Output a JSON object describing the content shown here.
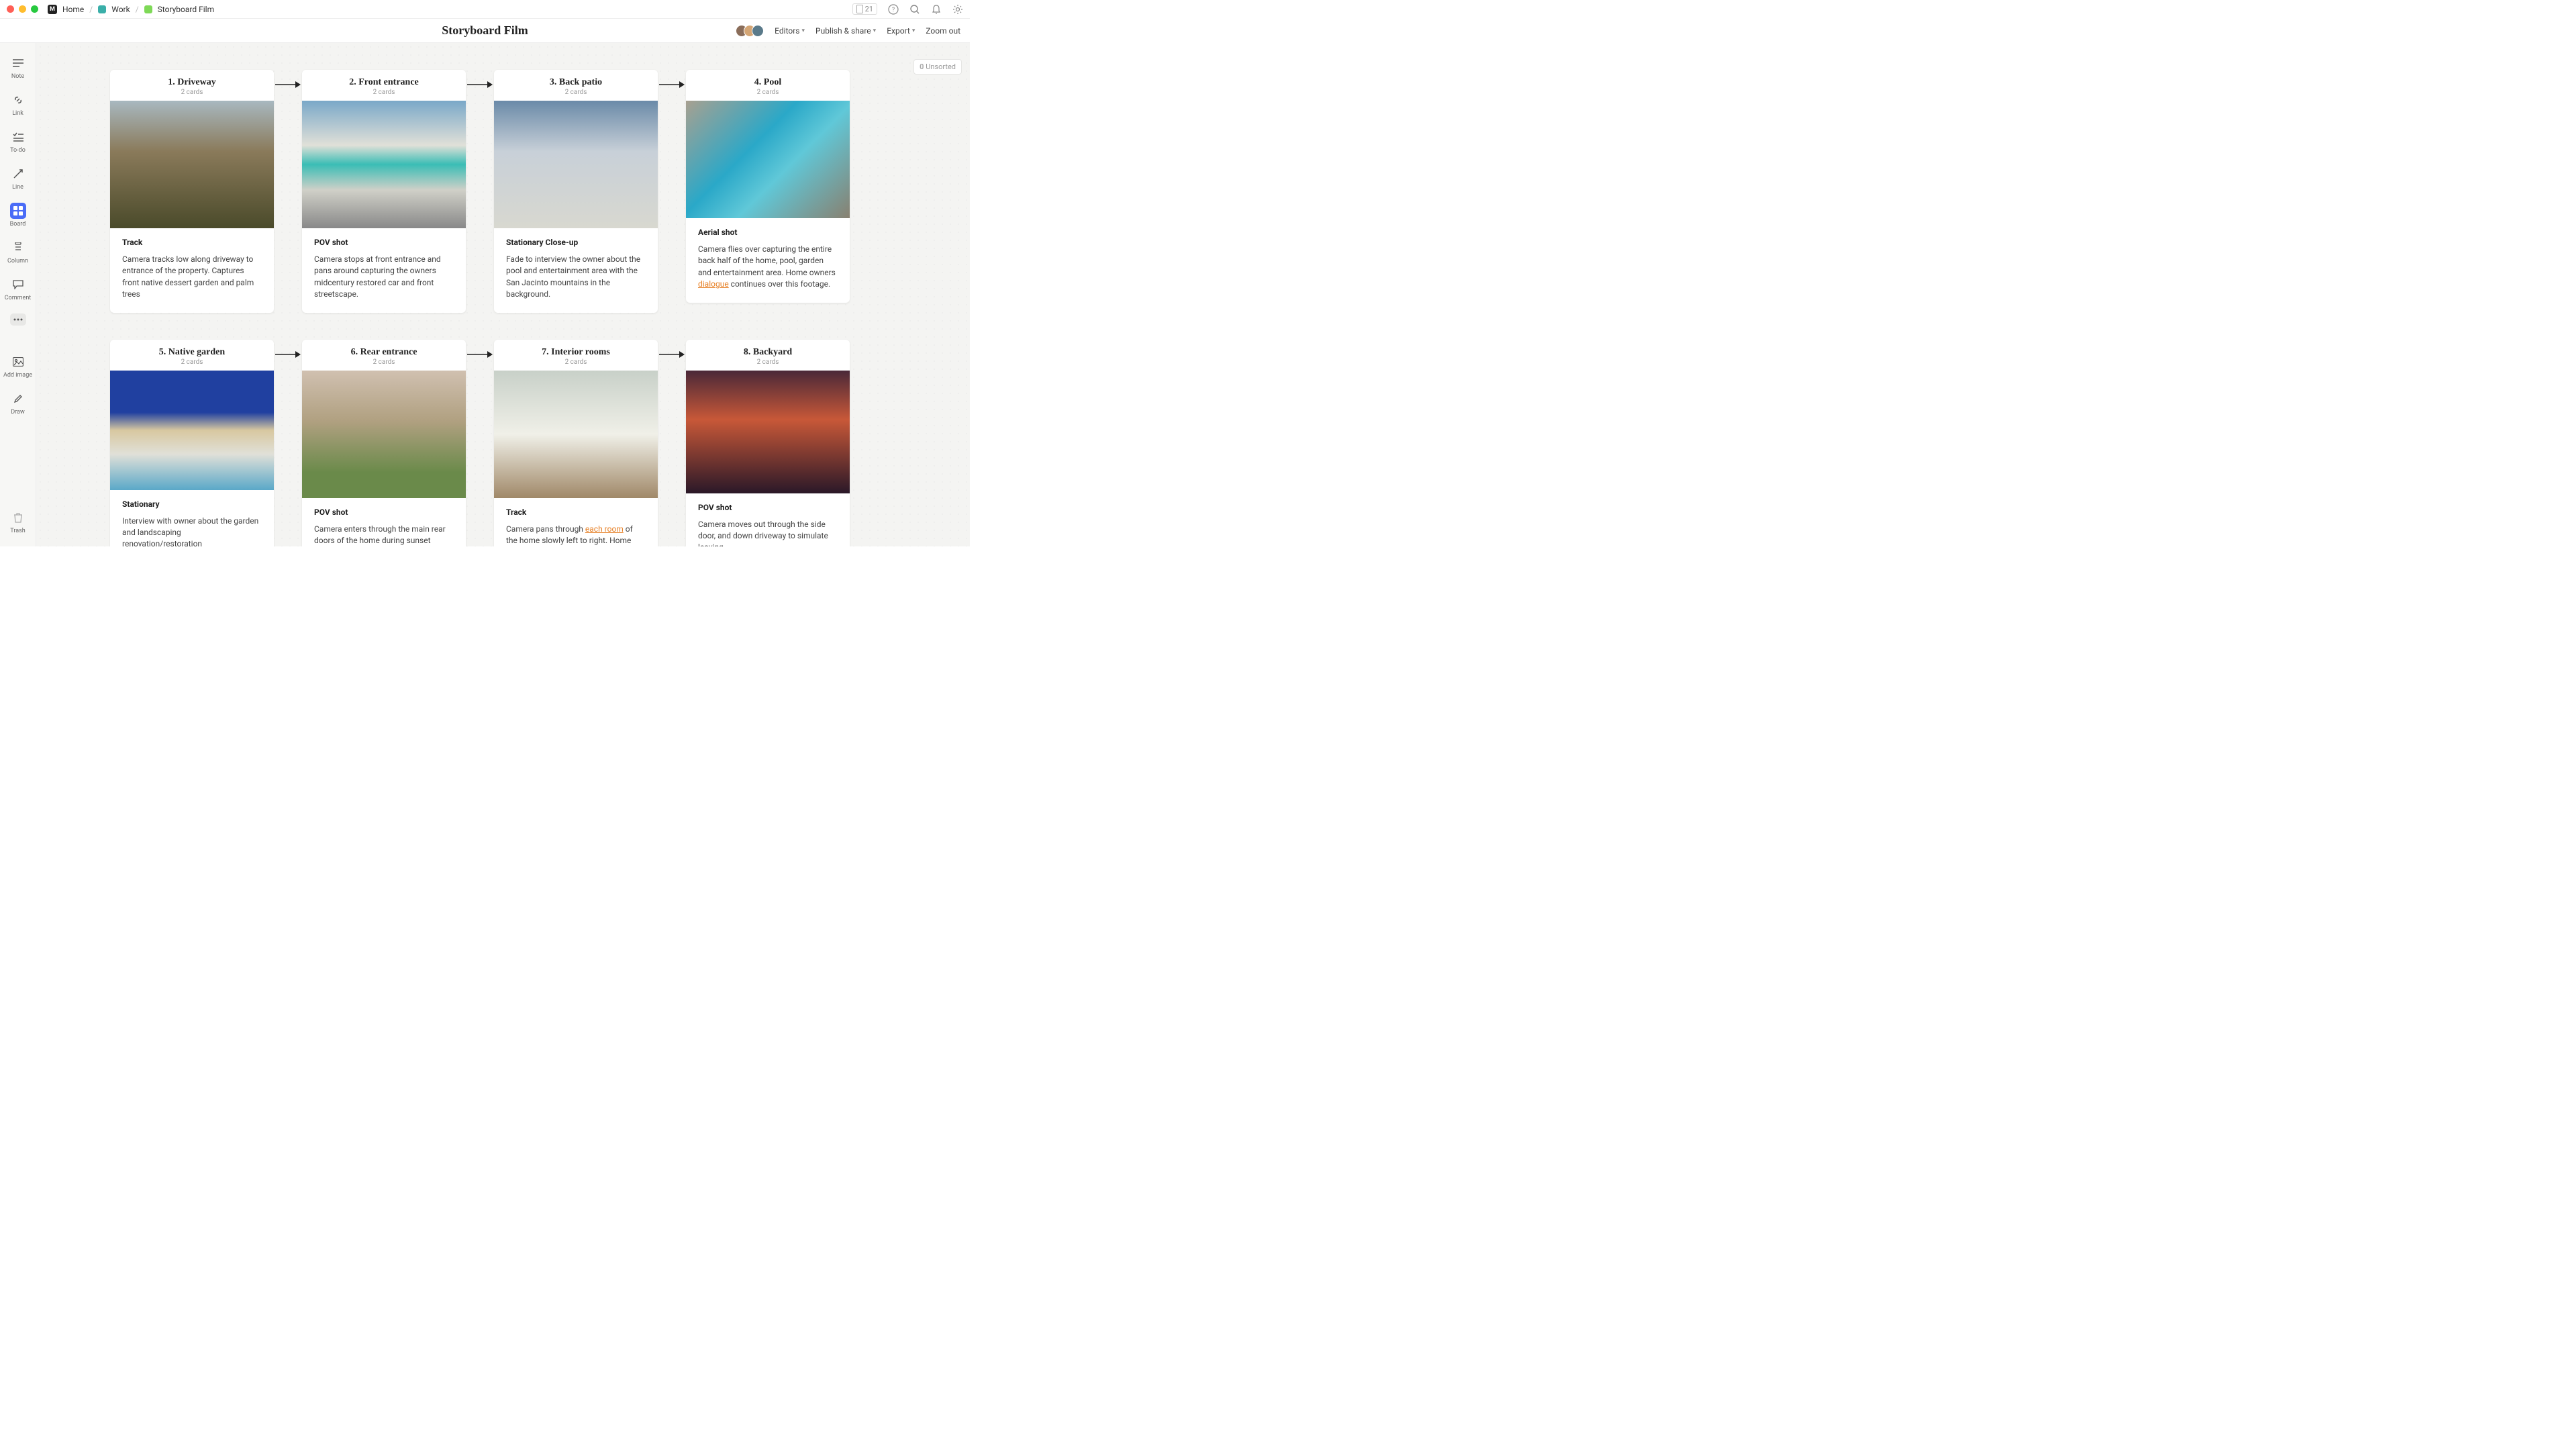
{
  "breadcrumb": {
    "home": "Home",
    "work": "Work",
    "current": "Storyboard Film"
  },
  "titlebar": {
    "counter": "21"
  },
  "header": {
    "title": "Storyboard Film",
    "editors": "Editors",
    "publish": "Publish & share",
    "export": "Export",
    "zoom": "Zoom out"
  },
  "toolbar": {
    "note": "Note",
    "link": "Link",
    "todo": "To-do",
    "line": "Line",
    "board": "Board",
    "column": "Column",
    "comment": "Comment",
    "addimage": "Add image",
    "draw": "Draw",
    "trash": "Trash"
  },
  "unsorted": {
    "count": "0",
    "label": "Unsorted"
  },
  "columns": [
    {
      "title": "1. Driveway",
      "meta": "2 cards",
      "shot_title": "Track",
      "shot_body": "Camera tracks low along driveway to entrance of the property. Captures front native dessert garden and palm trees"
    },
    {
      "title": "2. Front entrance",
      "meta": "2 cards",
      "shot_title": "POV shot",
      "shot_body": "Camera stops at front entrance and pans around capturing the owners midcentury restored car and front streetscape."
    },
    {
      "title": "3. Back patio",
      "meta": "2 cards",
      "shot_title": "Stationary Close-up",
      "shot_body": "Fade to interview the owner about the pool and entertainment area with the San Jacinto mountains in the background."
    },
    {
      "title": "4. Pool",
      "meta": "2 cards",
      "shot_title": "Aerial shot",
      "shot_body_pre": "Camera flies over capturing the entire back half of the home, pool, garden and entertainment area. Home owners ",
      "link": "dialogue",
      "shot_body_post": " continues over this footage."
    },
    {
      "title": "5. Native garden",
      "meta": "2 cards",
      "shot_title": "Stationary",
      "shot_body": "Interview with owner about the garden and landscaping renovation/restoration"
    },
    {
      "title": "6. Rear entrance",
      "meta": "2 cards",
      "shot_title": "POV shot",
      "shot_body": "Camera enters through the main rear doors of the home during sunset"
    },
    {
      "title": "7. Interior rooms",
      "meta": "2 cards",
      "shot_title": "Track",
      "shot_body_pre": "Camera pans through ",
      "link": "each room",
      "shot_body_post": " of the home slowly left to right. Home owners"
    },
    {
      "title": "8. Backyard",
      "meta": "2 cards",
      "shot_title": "POV shot",
      "shot_body": "Camera moves out through the side door, and down driveway to simulate leaving"
    }
  ]
}
